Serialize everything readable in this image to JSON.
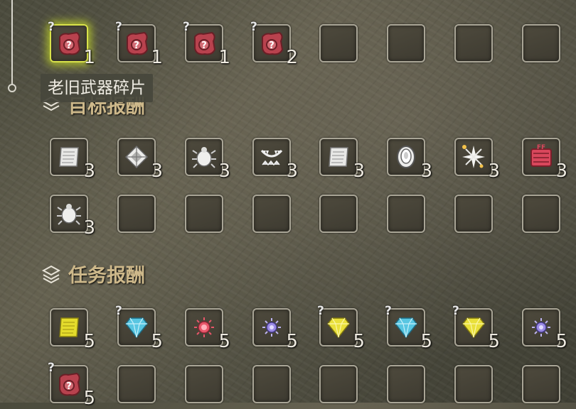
{
  "colors": {
    "accent": "#cdb88a",
    "highlight": "#d9e24a"
  },
  "tooltip": {
    "text": "老旧武器碎片"
  },
  "sections": {
    "target_rewards": {
      "title": "目标报酬"
    },
    "quest_rewards": {
      "title": "任务报酬"
    }
  },
  "rows": {
    "row1": {
      "items": [
        {
          "icon": "old-weapon-fragment-icon",
          "qty": "1",
          "unknown": true,
          "selected": true
        },
        {
          "icon": "old-weapon-fragment-icon",
          "qty": "1",
          "unknown": true
        },
        {
          "icon": "old-weapon-fragment-icon",
          "qty": "1",
          "unknown": true
        },
        {
          "icon": "old-weapon-fragment-icon",
          "qty": "2",
          "unknown": true
        },
        {
          "icon": "empty"
        },
        {
          "icon": "empty"
        },
        {
          "icon": "empty"
        },
        {
          "icon": "empty"
        }
      ]
    },
    "row2": {
      "items": [
        {
          "icon": "scroll-icon",
          "qty": "3"
        },
        {
          "icon": "scale-icon",
          "qty": "3"
        },
        {
          "icon": "bug-icon",
          "qty": "3"
        },
        {
          "icon": "jaw-icon",
          "qty": "3"
        },
        {
          "icon": "scroll-icon",
          "qty": "3"
        },
        {
          "icon": "shell-icon",
          "qty": "3"
        },
        {
          "icon": "sparkle-icon",
          "qty": "3"
        },
        {
          "icon": "red-ticket-icon",
          "qty": "3"
        }
      ]
    },
    "row3": {
      "items": [
        {
          "icon": "bug-icon",
          "qty": "3"
        },
        {
          "icon": "empty"
        },
        {
          "icon": "empty"
        },
        {
          "icon": "empty"
        },
        {
          "icon": "empty"
        },
        {
          "icon": "empty"
        },
        {
          "icon": "empty"
        },
        {
          "icon": "empty"
        }
      ]
    },
    "row4": {
      "items": [
        {
          "icon": "yellow-scroll-icon",
          "qty": "5"
        },
        {
          "icon": "blue-gem-icon",
          "qty": "5",
          "unknown": true
        },
        {
          "icon": "red-jewel-icon",
          "qty": "5"
        },
        {
          "icon": "purple-jewel-icon",
          "qty": "5"
        },
        {
          "icon": "yellow-gem-icon",
          "qty": "5",
          "unknown": true
        },
        {
          "icon": "blue-gem-icon",
          "qty": "5",
          "unknown": true
        },
        {
          "icon": "yellow-gem-icon",
          "qty": "5",
          "unknown": true
        },
        {
          "icon": "purple-jewel-icon",
          "qty": "5"
        }
      ]
    },
    "row5": {
      "items": [
        {
          "icon": "old-weapon-fragment-icon",
          "qty": "5",
          "unknown": true
        },
        {
          "icon": "empty"
        },
        {
          "icon": "empty"
        },
        {
          "icon": "empty"
        },
        {
          "icon": "empty"
        },
        {
          "icon": "empty"
        },
        {
          "icon": "empty"
        },
        {
          "icon": "empty"
        }
      ]
    }
  }
}
